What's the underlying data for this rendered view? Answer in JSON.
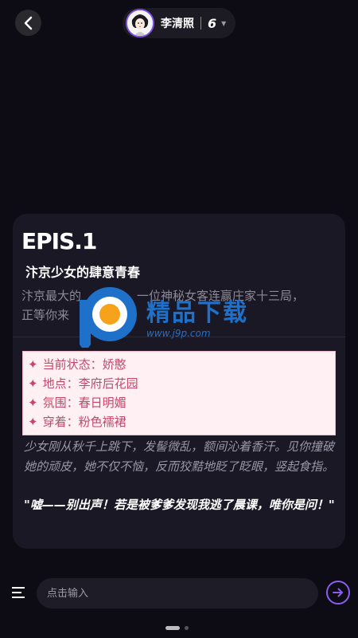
{
  "header": {
    "character_name": "李清照",
    "level": "6"
  },
  "episode": {
    "title": "EPIS.1",
    "subtitle": "汴京少女的肆意青春",
    "description_line1": "汴京最大的",
    "description_line1_end": "一位神秘女客连赢庄家十三局，",
    "description_line2": "正等你来",
    "status": [
      {
        "label": "当前状态：",
        "value": "娇憨"
      },
      {
        "label": "地点：",
        "value": "李府后花园"
      },
      {
        "label": "氛围：",
        "value": "春日明媚"
      },
      {
        "label": "穿着：",
        "value": "粉色襦裙"
      }
    ],
    "narration": "少女刚从秋千上跳下，发髻微乱，额间沁着香汗。见你撞破她的顽皮，她不仅不恼，反而狡黠地眨了眨眼，竖起食指。",
    "dialogue": "\"嘘——别出声！若是被爹爹发现我逃了晨课，唯你是问！\""
  },
  "watermark": {
    "text": "精品下载",
    "url": "www.j9p.com"
  },
  "input": {
    "placeholder": "点击输入"
  },
  "icons": {
    "back": "chevron-left-icon",
    "menu": "menu-icon",
    "send": "arrow-right-icon",
    "caret": "caret-down-icon"
  },
  "colors": {
    "background": "#0d0c14",
    "card": "#1a1825",
    "accent": "#8a5cf0",
    "status_text": "#c4476a",
    "status_bg": "#fff0f3"
  }
}
